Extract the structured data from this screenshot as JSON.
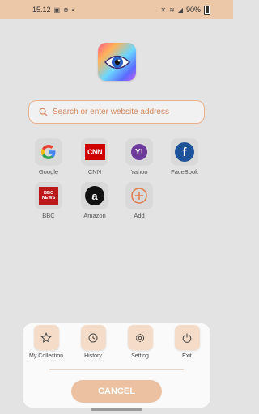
{
  "status_bar": {
    "time": "15.12",
    "battery": "90%",
    "icons": [
      "image-icon",
      "sync-icon",
      "dot-icon",
      "mute-icon",
      "wifi-icon",
      "signal-icon"
    ]
  },
  "search": {
    "placeholder": "Search or enter website address",
    "value": ""
  },
  "sites": [
    {
      "label": "Google",
      "icon": "google-icon"
    },
    {
      "label": "CNN",
      "icon": "cnn-icon"
    },
    {
      "label": "Yahoo",
      "icon": "yahoo-icon"
    },
    {
      "label": "FaceBook",
      "icon": "facebook-icon"
    },
    {
      "label": "BBC",
      "icon": "bbc-icon",
      "logo_lines": [
        "BBC",
        "NEWS"
      ]
    },
    {
      "label": "Amazon",
      "icon": "amazon-icon"
    },
    {
      "label": "Add",
      "icon": "add-icon"
    }
  ],
  "sheet": {
    "actions": [
      {
        "label": "My Collection",
        "icon": "star-icon"
      },
      {
        "label": "History",
        "icon": "history-icon"
      },
      {
        "label": "Setting",
        "icon": "gear-icon"
      },
      {
        "label": "Exit",
        "icon": "power-icon"
      }
    ],
    "cancel_label": "CANCEL"
  },
  "colors": {
    "accent": "#ecc7a8",
    "search_border": "#e8b18a",
    "placeholder": "#d4875a",
    "cancel_button": "#ecc1a1"
  }
}
